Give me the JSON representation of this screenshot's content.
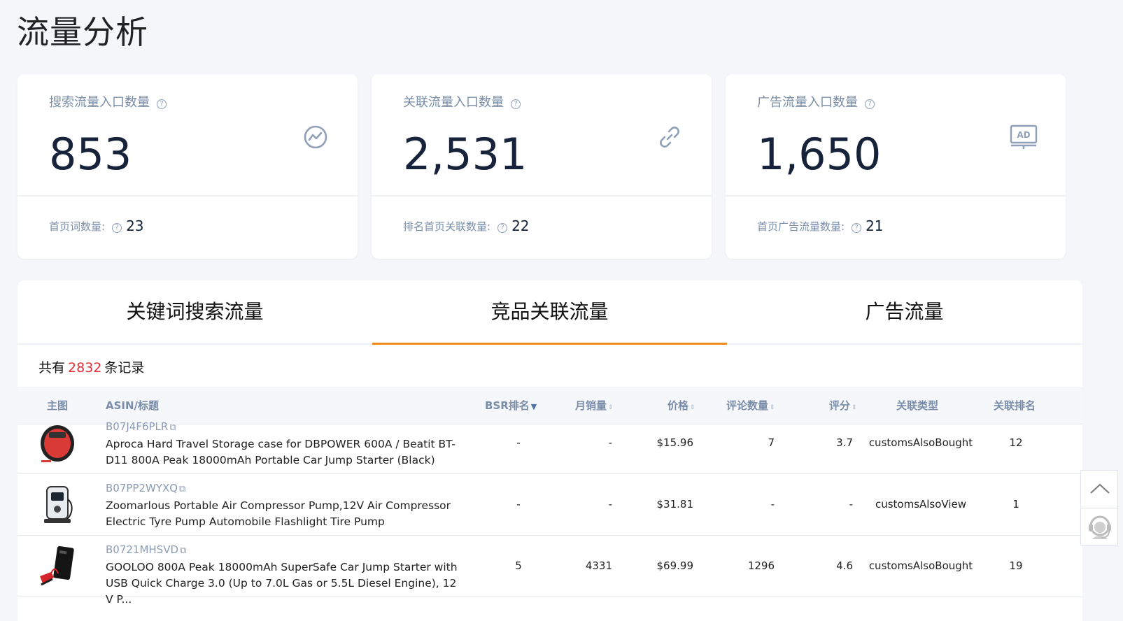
{
  "page": {
    "title": "流量分析"
  },
  "cards": [
    {
      "label": "搜索流量入口数量",
      "value": "853",
      "icon": "trend-chart-icon",
      "sub_label": "首页词数量:",
      "sub_value": "23"
    },
    {
      "label": "关联流量入口数量",
      "value": "2,531",
      "icon": "link-icon",
      "sub_label": "排名首页关联数量:",
      "sub_value": "22"
    },
    {
      "label": "广告流量入口数量",
      "value": "1,650",
      "icon": "ad-icon",
      "sub_label": "首页广告流量数量:",
      "sub_value": "21"
    }
  ],
  "icons": {
    "ad_text": "AD",
    "help_glyph": "?",
    "external_link": "⧉",
    "scroll_top": "chevron-up-icon",
    "support": "customer-service-icon"
  },
  "tabs": [
    {
      "label": "关键词搜索流量",
      "active": false
    },
    {
      "label": "竞品关联流量",
      "active": true
    },
    {
      "label": "广告流量",
      "active": false
    }
  ],
  "records": {
    "prefix": "共有",
    "count": "2832",
    "suffix": "条记录"
  },
  "table": {
    "headers": {
      "image": "主图",
      "asin_title": "ASIN/标题",
      "bsr": "BSR排名",
      "monthly_sales": "月销量",
      "price": "价格",
      "reviews": "评论数量",
      "rating": "评分",
      "relation_type": "关联类型",
      "relation_rank": "关联排名"
    },
    "sort_glyphs": {
      "sortable": "⇕",
      "desc": "▼"
    },
    "rows": [
      {
        "asin": "B07J4F6PLR",
        "title": "Aproca Hard Travel Storage case for DBPOWER 600A / Beatit BT-D11 800A Peak 18000mAh Portable Car Jump Starter (Black)",
        "bsr": "-",
        "monthly_sales": "-",
        "price": "$15.96",
        "reviews": "7",
        "rating": "3.7",
        "relation_type": "customsAlsoBought",
        "relation_rank": "12"
      },
      {
        "asin": "B07PP2WYXQ",
        "title": "Zoomarlous Portable Air Compressor Pump,12V Air Compressor Electric Tyre Pump Automobile Flashlight Tire Pump",
        "bsr": "-",
        "monthly_sales": "-",
        "price": "$31.81",
        "reviews": "-",
        "rating": "-",
        "relation_type": "customsAlsoView",
        "relation_rank": "1"
      },
      {
        "asin": "B0721MHSVD",
        "title": "GOOLOO 800A Peak 18000mAh SuperSafe Car Jump Starter with USB Quick Charge 3.0 (Up to 7.0L Gas or 5.5L Diesel Engine), 12V P...",
        "bsr": "5",
        "monthly_sales": "4331",
        "price": "$69.99",
        "reviews": "1296",
        "rating": "4.6",
        "relation_type": "customsAlsoBought",
        "relation_rank": "19"
      }
    ]
  },
  "colors": {
    "accent": "#ef8a1e",
    "count_red": "#e0313a",
    "muted": "#7a8da8",
    "background": "#f4f6fa"
  }
}
